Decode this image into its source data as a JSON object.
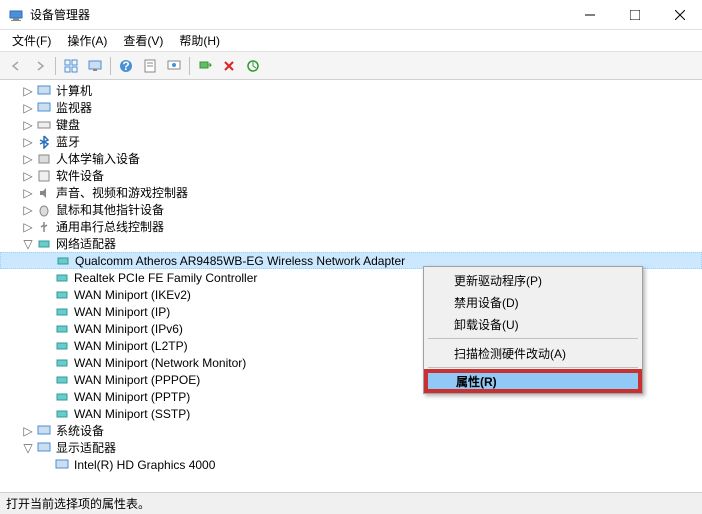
{
  "window": {
    "title": "设备管理器"
  },
  "menu": {
    "file": "文件(F)",
    "action": "操作(A)",
    "view": "查看(V)",
    "help": "帮助(H)"
  },
  "tree": {
    "computers": "计算机",
    "monitors": "监视器",
    "keyboards": "键盘",
    "bluetooth": "蓝牙",
    "hid": "人体学输入设备",
    "software": "软件设备",
    "sound": "声音、视频和游戏控制器",
    "mice": "鼠标和其他指针设备",
    "usb": "通用串行总线控制器",
    "network": "网络适配器",
    "net_items": {
      "qualcomm": "Qualcomm Atheros AR9485WB-EG Wireless Network Adapter",
      "realtek": "Realtek PCIe FE Family Controller",
      "ikev2": "WAN Miniport (IKEv2)",
      "ip": "WAN Miniport (IP)",
      "ipv6": "WAN Miniport (IPv6)",
      "l2tp": "WAN Miniport (L2TP)",
      "netmon": "WAN Miniport (Network Monitor)",
      "pppoe": "WAN Miniport (PPPOE)",
      "pptp": "WAN Miniport (PPTP)",
      "sstp": "WAN Miniport (SSTP)"
    },
    "system": "系统设备",
    "display": "显示适配器",
    "intel_hd": "Intel(R) HD Graphics 4000"
  },
  "context": {
    "update_driver": "更新驱动程序(P)",
    "disable": "禁用设备(D)",
    "uninstall": "卸载设备(U)",
    "scan": "扫描检测硬件改动(A)",
    "properties": "属性(R)"
  },
  "status": {
    "text": "打开当前选择项的属性表。"
  }
}
